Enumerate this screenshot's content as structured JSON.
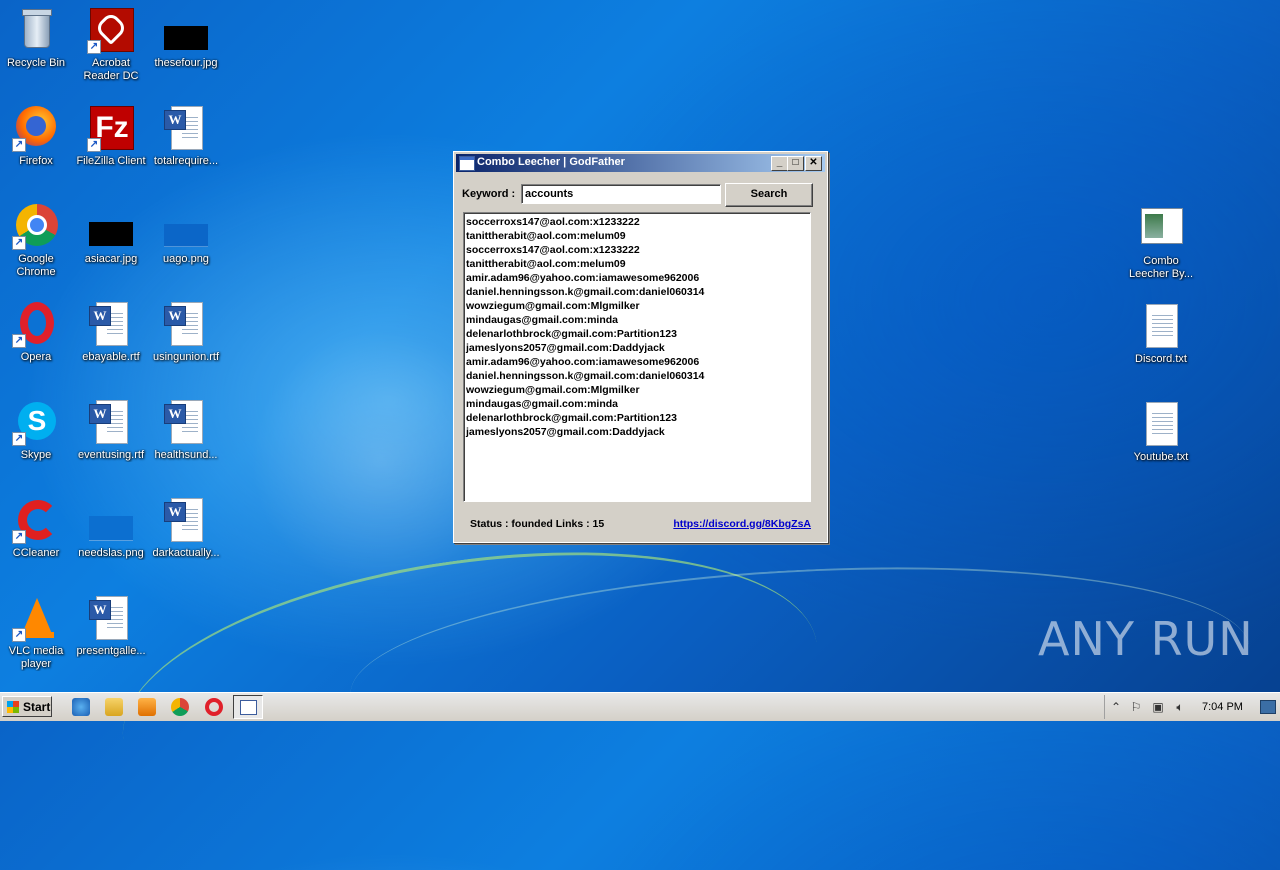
{
  "desktop": {
    "icons": [
      {
        "label": "Recycle Bin",
        "icon": "recycle-bin-icon"
      },
      {
        "label": "Acrobat Reader DC",
        "icon": "acrobat-icon"
      },
      {
        "label": "thesefour.jpg",
        "icon": "image-icon"
      },
      {
        "label": "Firefox",
        "icon": "firefox-icon"
      },
      {
        "label": "FileZilla Client",
        "icon": "filezilla-icon"
      },
      {
        "label": "totalrequire...",
        "icon": "word-doc-icon"
      },
      {
        "label": "Google Chrome",
        "icon": "chrome-icon"
      },
      {
        "label": "asiacar.jpg",
        "icon": "image-icon"
      },
      {
        "label": "uago.png",
        "icon": "image-icon"
      },
      {
        "label": "Opera",
        "icon": "opera-icon"
      },
      {
        "label": "ebayable.rtf",
        "icon": "word-doc-icon"
      },
      {
        "label": "usingunion.rtf",
        "icon": "word-doc-icon"
      },
      {
        "label": "Skype",
        "icon": "skype-icon"
      },
      {
        "label": "eventusing.rtf",
        "icon": "word-doc-icon"
      },
      {
        "label": "healthsund...",
        "icon": "word-doc-icon"
      },
      {
        "label": "CCleaner",
        "icon": "ccleaner-icon"
      },
      {
        "label": "needslas.png",
        "icon": "image-icon"
      },
      {
        "label": "darkactually...",
        "icon": "word-doc-icon"
      },
      {
        "label": "VLC media player",
        "icon": "vlc-icon"
      },
      {
        "label": "presentgalle...",
        "icon": "word-doc-icon"
      },
      {
        "label": "Combo Leecher By...",
        "icon": "app-window-icon"
      },
      {
        "label": "Discord.txt",
        "icon": "text-file-icon"
      },
      {
        "label": "Youtube.txt",
        "icon": "text-file-icon"
      }
    ]
  },
  "window": {
    "title": "Combo Leecher | GodFather",
    "minimize": "_",
    "maximize": "□",
    "close": "✕",
    "keyword_label": "Keyword :",
    "keyword_value": "accounts",
    "search_label": "Search",
    "results": [
      "soccerroxs147@aol.com:x1233222",
      "tanittherabit@aol.com:melum09",
      "soccerroxs147@aol.com:x1233222",
      "tanittherabit@aol.com:melum09",
      "amir.adam96@yahoo.com:iamawesome962006",
      "daniel.henningsson.k@gmail.com:daniel060314",
      "wowziegum@gmail.com:Mlgmilker",
      "mindaugas@gmail.com:minda",
      "delenarlothbrock@gmail.com:Partition123",
      "jameslyons2057@gmail.com:Daddyjack",
      "amir.adam96@yahoo.com:iamawesome962006",
      "daniel.henningsson.k@gmail.com:daniel060314",
      "wowziegum@gmail.com:Mlgmilker",
      "mindaugas@gmail.com:minda",
      "delenarlothbrock@gmail.com:Partition123",
      "jameslyons2057@gmail.com:Daddyjack"
    ],
    "status": "Status : founded Links : 15",
    "link": "https://discord.gg/8KbgZsA"
  },
  "taskbar": {
    "start_label": "Start",
    "clock": "7:04 PM",
    "quick_launch": [
      "ie-icon",
      "explorer-icon",
      "media-player-icon",
      "chrome-icon",
      "opera-icon",
      "app-window-icon"
    ]
  },
  "watermark": "ANY RUN",
  "colors": {
    "title_gradient_start": "#0a246a",
    "title_gradient_end": "#a6caf0",
    "link": "#0000cc"
  }
}
